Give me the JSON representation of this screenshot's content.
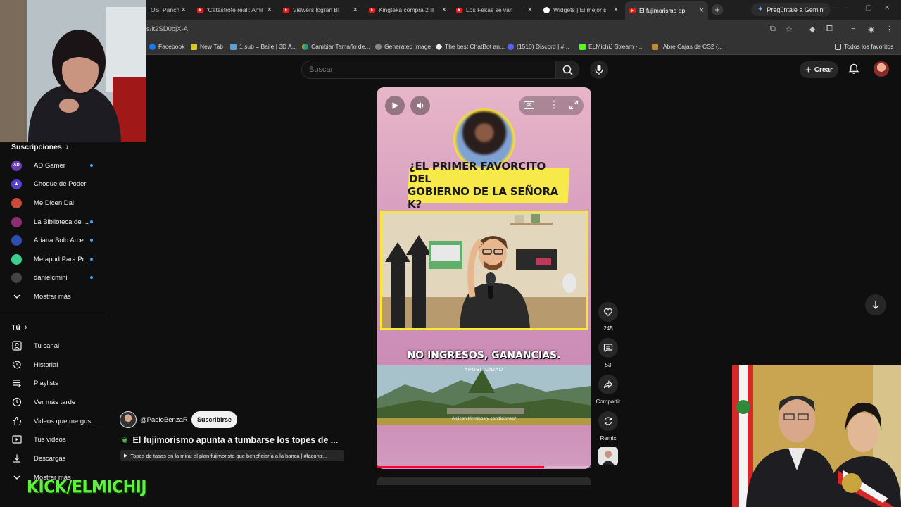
{
  "browser": {
    "tabs": [
      {
        "label": "OS: Panch"
      },
      {
        "label": "'Catástrofe real': Amil"
      },
      {
        "label": "Viewers logran Bl"
      },
      {
        "label": "Kingteka compra 2 lll"
      },
      {
        "label": "Los Fekas se van"
      },
      {
        "label": "Widgets | El mejor s"
      },
      {
        "label": "El fujimorismo ap"
      }
    ],
    "gemini_label": "Pregúntale a Gemini",
    "url": "s/lt2SD0ojX-A",
    "bookmarks": [
      {
        "label": "Facebook"
      },
      {
        "label": "New Tab"
      },
      {
        "label": "1 sub = Baile | 3D A..."
      },
      {
        "label": "Cambiar Tamaño de..."
      },
      {
        "label": "Generated Image"
      },
      {
        "label": "The best ChatBot an..."
      },
      {
        "label": "(1510) Discord | #..."
      },
      {
        "label": "ELMichiJ Stream -..."
      },
      {
        "label": "¡Abre Cajas de CS2 (..."
      }
    ],
    "all_bookmarks": "Todos los favoritos"
  },
  "header": {
    "search_placeholder": "Buscar",
    "create_label": "Crear"
  },
  "sidebar": {
    "subscriptions_title": "Suscripciones",
    "subscriptions": [
      {
        "name": "AD Gamer",
        "initials": "AD",
        "color": "#6a3fb5",
        "new": true
      },
      {
        "name": "Choque de Poder",
        "initials": "",
        "color": "#5a3ec9",
        "new": false
      },
      {
        "name": "Me Dicen Dal",
        "initials": "",
        "color": "#c94a3a",
        "new": false
      },
      {
        "name": "La Biblioteca de ...",
        "initials": "",
        "color": "#8a2e6e",
        "new": true
      },
      {
        "name": "Ariana Bolo Arce",
        "initials": "",
        "color": "#2f4fb0",
        "new": true
      },
      {
        "name": "Metapod Para Pr...",
        "initials": "",
        "color": "#3ccf8e",
        "new": true
      },
      {
        "name": "danielcmini",
        "initials": "",
        "color": "#444444",
        "new": true
      }
    ],
    "show_more": "Mostrar más",
    "you_title": "Tú",
    "you_items": [
      {
        "label": "Tu canal",
        "icon": "person-icon"
      },
      {
        "label": "Historial",
        "icon": "history-icon"
      },
      {
        "label": "Playlists",
        "icon": "playlist-icon"
      },
      {
        "label": "Ver más tarde",
        "icon": "clock-icon"
      },
      {
        "label": "Videos que me gus...",
        "icon": "thumb-up-icon"
      },
      {
        "label": "Tus videos",
        "icon": "video-icon"
      },
      {
        "label": "Descargas",
        "icon": "download-icon"
      },
      {
        "label": "Mostrar más",
        "icon": "chevron-down-icon"
      }
    ]
  },
  "short": {
    "headline_line1": "¿EL PRIMER FAVORCITO DEL",
    "headline_line2": "GOBIERNO DE LA SEÑORA K?",
    "caption": "NO INGRESOS, GANANCIAS.",
    "ad_tag": "#PUBLICIDAD",
    "ad_note": "Aplican términos y condiciones*",
    "progress": 0.78
  },
  "actions": {
    "likes": "245",
    "comments": "53",
    "share": "Compartir",
    "remix": "Remix"
  },
  "channel": {
    "handle": "@PaoloBenzaR",
    "subscribe": "Suscribirse"
  },
  "video": {
    "title": "El fujimorismo apunta a tumbarse los topes de ...",
    "playlist": "Topes de tasas en la mira: el plan fujimorista que beneficiaría a la banca | #lacontr..."
  },
  "overlay": {
    "kick_text": "KICK/ELMICHIJ"
  }
}
